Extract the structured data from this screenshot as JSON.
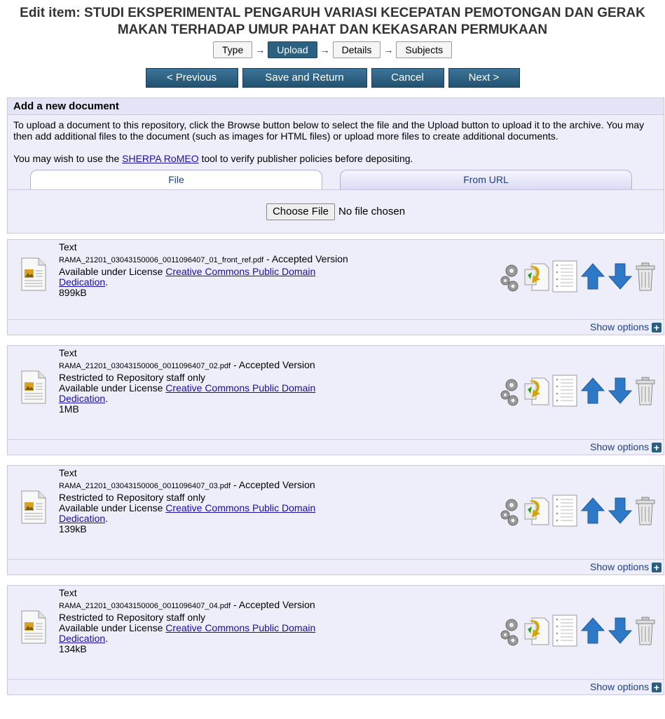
{
  "title": "Edit item: STUDI EKSPERIMENTAL PENGARUH VARIASI KECEPATAN PEMOTONGAN DAN GERAK MAKAN TERHADAP UMUR PAHAT DAN KEKASARAN PERMUKAAN",
  "stages": [
    "Type",
    "Upload",
    "Details",
    "Subjects"
  ],
  "stage_arrow": "→",
  "buttons": {
    "previous": "< Previous",
    "save": "Save and Return",
    "cancel": "Cancel",
    "next": "Next >"
  },
  "upload": {
    "heading": "Add a new document",
    "intro": "To upload a document to this repository, click the Browse button below to select the file and the Upload button to upload it to the archive. You may then add additional files to the document (such as images for HTML files) or upload more files to create additional documents.",
    "sherpa_pre": "You may wish to use the ",
    "sherpa_link": "SHERPA RoMEO",
    "sherpa_post": " tool to verify publisher policies before depositing.",
    "tab_file": "File",
    "tab_url": "From URL",
    "choose_file": "Choose File",
    "no_file": "No file chosen"
  },
  "common": {
    "type": "Text",
    "version_sep": " - ",
    "version": "Accepted Version",
    "restricted": "Restricted to Repository staff only",
    "license_pre": "Available under License ",
    "license_link": "Creative Commons Public Domain Dedication",
    "license_post": ".",
    "show_options": "Show options",
    "plus": "+"
  },
  "documents": [
    {
      "filename": "RAMA_21201_03043150006_0011096407_01_front_ref.pdf",
      "size": "899kB"
    },
    {
      "filename": "RAMA_21201_03043150006_0011096407_02.pdf",
      "size": "1MB"
    },
    {
      "filename": "RAMA_21201_03043150006_0011096407_03.pdf",
      "size": "139kB"
    },
    {
      "filename": "RAMA_21201_03043150006_0011096407_04.pdf",
      "size": "134kB"
    }
  ],
  "icons": [
    "gears-icon",
    "convert-icon",
    "details-icon",
    "move-up-icon",
    "move-down-icon",
    "trash-icon"
  ]
}
